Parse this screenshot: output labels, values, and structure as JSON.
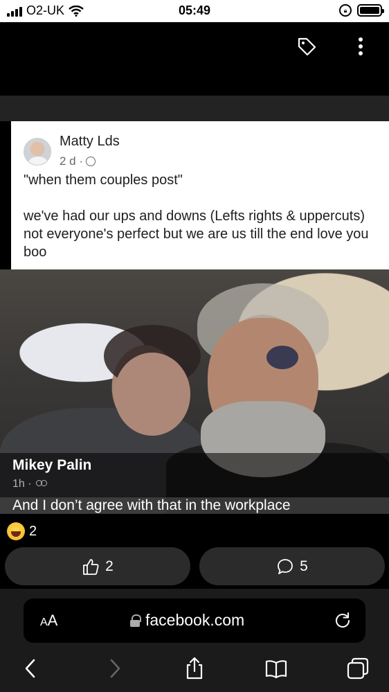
{
  "status_bar": {
    "carrier": "O2-UK",
    "time": "05:49"
  },
  "shared_post": {
    "author": "Matty Lds",
    "meta": "2 d ·",
    "quote": "\"when them couples post\"",
    "body": "we've had our ups and downs (Lefts rights & uppercuts) not everyone's perfect but we are us till the end love you boo"
  },
  "comment": {
    "author": "Mikey Palin",
    "meta": "1h ·",
    "text": "And I don’t agree with that in the workplace"
  },
  "reactions": {
    "haha_count": "2",
    "like_count": "2",
    "comment_count": "5"
  },
  "browser": {
    "aa_label_small": "A",
    "aa_label_large": "A",
    "url": "facebook.com"
  },
  "colors": {
    "background": "#000000",
    "pill": "#2b2b2b",
    "safari_bar": "#1b1b1b"
  }
}
